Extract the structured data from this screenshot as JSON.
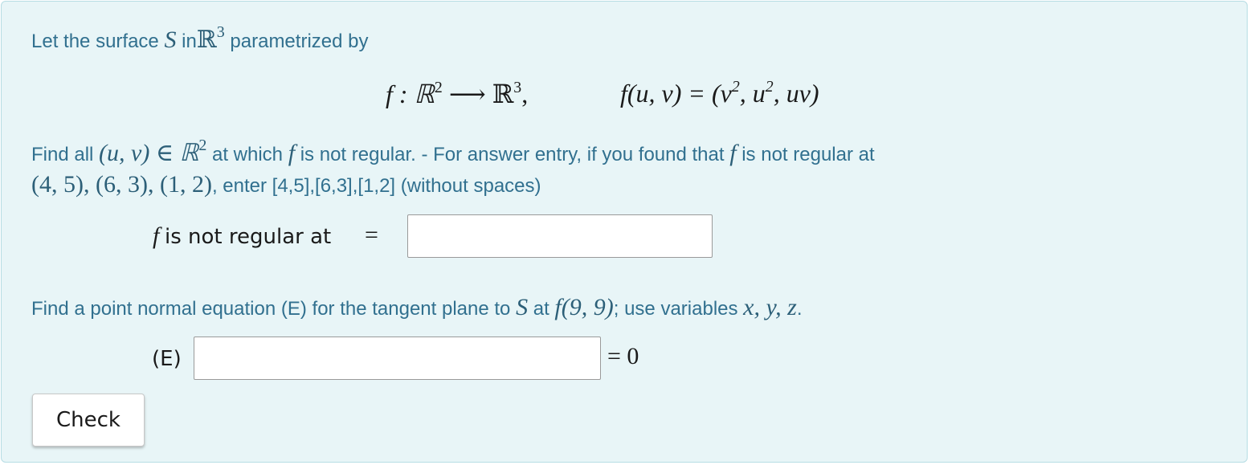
{
  "intro": {
    "prefix": "Let the surface",
    "var_S": "S",
    "in": "in",
    "R": "ℝ",
    "exp3": "3",
    "suffix": "parametrized by"
  },
  "display": {
    "map": "f : ℝ",
    "exp2": "2",
    "arrow": "⟶ ℝ",
    "exp3": "3",
    "comma": ",",
    "lhs": "f(u, v) = (v",
    "exp_v": "2",
    "mid": ", u",
    "exp_u": "2",
    "rhs": ", uv)"
  },
  "q1": {
    "find_all": "Find all",
    "uv": "(u, v) ∈ ℝ",
    "exp2": "2",
    "at_which": "at which",
    "f1": "f",
    "not_regular": "is not regular. - For answer entry, if you found that",
    "f2": "f",
    "is_not_regular_at": "is not regular at",
    "points_math": "(4, 5), (6, 3), (1, 2)",
    "enter_text": ", enter [4,5],[6,3],[1,2] (without spaces)",
    "answer_f": "f",
    "answer_label": "is not regular at",
    "equals": "=",
    "input_value": ""
  },
  "q2": {
    "prefix": "Find a point normal equation (E) for the tangent plane to",
    "var_S": "S",
    "at": "at",
    "point": "f(9, 9)",
    "use": "; use variables",
    "vars": "x, y, z",
    "period": ".",
    "label": "(E)",
    "equals_zero": "= 0",
    "input_value": ""
  },
  "check_button": {
    "label": "Check"
  }
}
